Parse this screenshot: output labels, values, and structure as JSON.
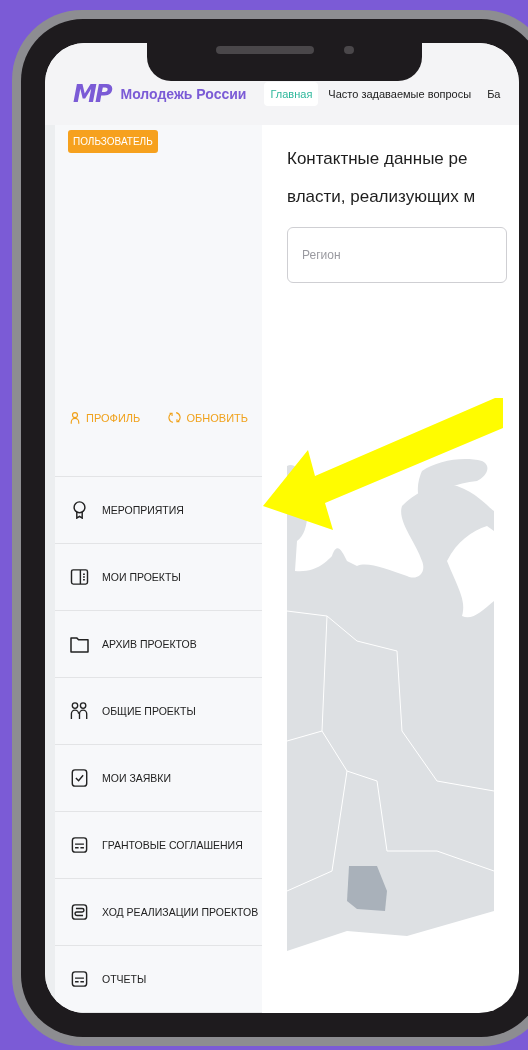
{
  "header": {
    "logo": "МР",
    "site_name": "Молодежь России",
    "nav": [
      {
        "label": "Главная",
        "selected": true
      },
      {
        "label": "Часто задаваемые вопросы",
        "selected": false
      },
      {
        "label": "Ба",
        "selected": false
      }
    ]
  },
  "sidebar": {
    "role_badge": "ПОЛЬЗОВАТЕЛЬ",
    "actions": [
      {
        "kind": "profile",
        "label": "ПРОФИЛЬ"
      },
      {
        "kind": "refresh",
        "label": "ОБНОВИТЬ"
      }
    ],
    "menu": [
      {
        "kind": "award",
        "label": "МЕРОПРИЯТИЯ"
      },
      {
        "kind": "panel",
        "label": "МОИ ПРОЕКТЫ"
      },
      {
        "kind": "folder",
        "label": "АРХИВ ПРОЕКТОВ"
      },
      {
        "kind": "people",
        "label": "ОБЩИЕ ПРОЕКТЫ"
      },
      {
        "kind": "check",
        "label": "МОИ ЗАЯВКИ"
      },
      {
        "kind": "list",
        "label": "ГРАНТОВЫЕ СОГЛАШЕНИЯ"
      },
      {
        "kind": "route",
        "label": "ХОД РЕАЛИЗАЦИИ ПРОЕКТОВ"
      },
      {
        "kind": "list",
        "label": "ОТЧЕТЫ"
      }
    ]
  },
  "main": {
    "title_lines": [
      "Контактные данные ре",
      "власти, реализующих м"
    ],
    "region_field": {
      "placeholder": "Регион"
    }
  }
}
